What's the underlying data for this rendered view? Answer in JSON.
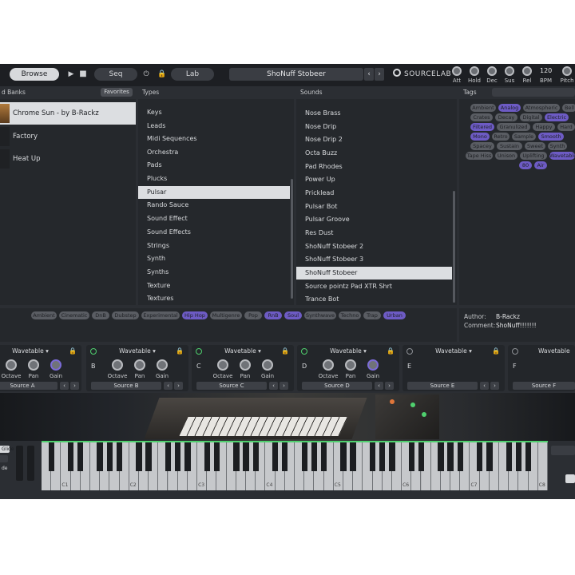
{
  "topbar": {
    "browse_label": "Browse",
    "seq_label": "Seq",
    "lab_label": "Lab",
    "preset_name": "ShoNuff Stobeer",
    "logo_text": "SOURCELAB",
    "bpm_value": "120",
    "knobs": [
      "Att",
      "Hold",
      "Dec",
      "Sus",
      "Rel",
      "BPM",
      "Pitch"
    ]
  },
  "headers": {
    "banks": "d Banks",
    "favorites": "Favorites",
    "types": "Types",
    "sounds": "Sounds",
    "tags": "Tags"
  },
  "banks": [
    "Chrome Sun - by B-Rackz",
    "Factory",
    "Heat Up"
  ],
  "types": [
    "Keys",
    "Leads",
    "Midi Sequences",
    "Orchestra",
    "Pads",
    "Plucks",
    "Pulsar",
    "Rando Sauce",
    "Sound Effect",
    "Sound Effects",
    "Strings",
    "Synth",
    "Synths",
    "Texture",
    "Textures"
  ],
  "sounds": [
    "Nose Brass",
    "Nose Drip",
    "Nose Drip 2",
    "Octa Buzz",
    "Pad Rhodes",
    "Power Up",
    "Pricklead",
    "Pulsar Bot",
    "Pulsar Groove",
    "Res Dust",
    "ShoNuff Stobeer 2",
    "ShoNuff Stobeer 3",
    "ShoNuff Stobeer",
    "Source pointz Pad XTR Shrt",
    "Trance Bot"
  ],
  "tags": [
    "Ambient",
    "Analog",
    "Atmospheric",
    "Bell",
    "Crates",
    "Decay",
    "Digital",
    "Electric",
    "Filtered",
    "Granulized",
    "Happy",
    "Hard",
    "Mono",
    "Retro",
    "Sample",
    "Smooth",
    "Spacey",
    "Sustain",
    "Sweet",
    "Synth",
    "Tape Hiss",
    "Unison",
    "Uplifting",
    "Wavetable",
    "80",
    "Air"
  ],
  "genre_tags": [
    "Ambient",
    "Cinematic",
    "DnB",
    "Dubstep",
    "Experimental",
    "Hip Hop",
    "Multigenre",
    "Pop",
    "RnB",
    "Soul",
    "Synthwave",
    "Techno",
    "Trap",
    "Urban"
  ],
  "info": {
    "author_label": "Author:",
    "author_value": "B-Rackz",
    "comment_label": "Comment:",
    "comment_value": "ShoNuff!!!!!!!"
  },
  "sources": [
    {
      "type": "Wavetable",
      "letter": "",
      "name": "Source A",
      "knobs": [
        "Octave",
        "Pan",
        "Gain"
      ]
    },
    {
      "type": "Wavetable",
      "letter": "B",
      "name": "Source B",
      "knobs": [
        "Octave",
        "Pan",
        "Gain"
      ]
    },
    {
      "type": "Wavetable",
      "letter": "C",
      "name": "Source C",
      "knobs": [
        "Octave",
        "Pan",
        "Gain"
      ]
    },
    {
      "type": "Wavetable",
      "letter": "D",
      "name": "Source D",
      "knobs": [
        "Octave",
        "Pan",
        "Gain"
      ]
    },
    {
      "type": "Wavetable",
      "letter": "E",
      "name": "Source E",
      "knobs": []
    },
    {
      "type": "Wavetable",
      "letter": "F",
      "name": "Source F",
      "knobs": []
    }
  ],
  "keyboard": {
    "octave_labels": [
      "C1",
      "C2",
      "C3",
      "C4",
      "C5",
      "C6",
      "C7",
      "C8"
    ],
    "side_labels": [
      "Glide",
      "",
      "de"
    ]
  },
  "colors": {
    "accent": "#6d5bc4",
    "power_on": "#4fd06e",
    "selected_row": "#dcdee1"
  }
}
